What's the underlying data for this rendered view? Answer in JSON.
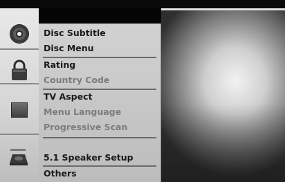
{
  "menu": {
    "items": [
      {
        "label": "Disc Subtitle",
        "dim": false
      },
      {
        "label": "Disc Menu",
        "dim": false
      },
      {
        "label": "Rating",
        "dim": false
      },
      {
        "label": "Country Code",
        "dim": true
      },
      {
        "label": "TV Aspect",
        "dim": false
      },
      {
        "label": "Menu Language",
        "dim": true
      },
      {
        "label": "Progressive Scan",
        "dim": true
      },
      {
        "label": "5.1 Speaker Setup",
        "dim": false
      },
      {
        "label": "Others",
        "dim": false
      }
    ]
  },
  "icons": {
    "disc": "disc-icon",
    "lock": "lock-icon",
    "tv": "tv-icon",
    "speaker": "speaker-icon"
  },
  "colors": {
    "menu_text": "#1a1a1a",
    "menu_text_dim": "#7c7c7c",
    "panel_bg": "#c9c9c9",
    "background": "#0c0c0c"
  }
}
